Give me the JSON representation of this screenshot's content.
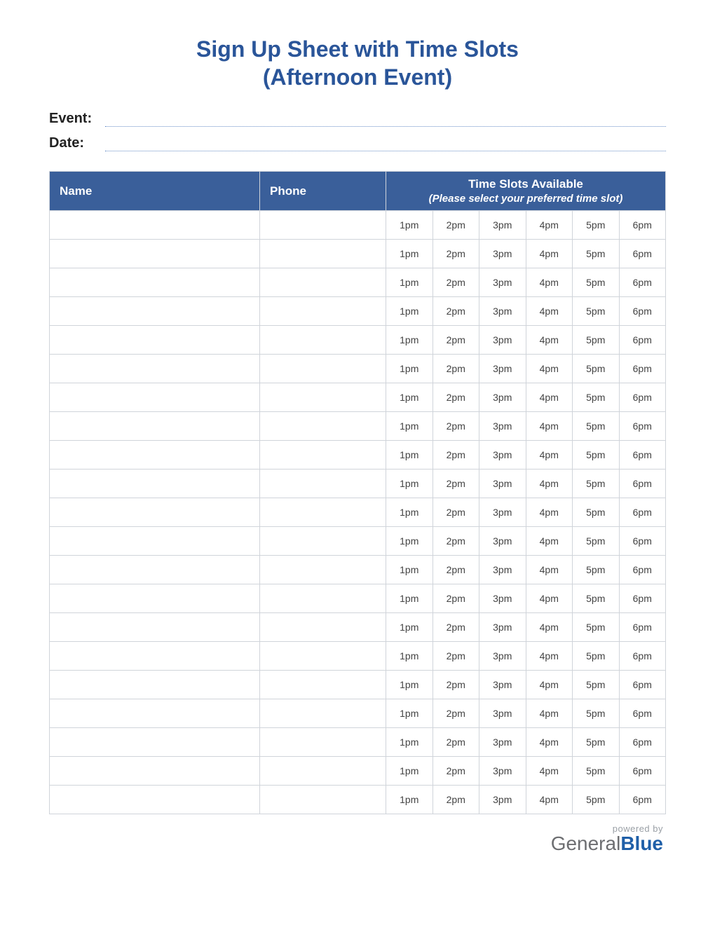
{
  "title_line1": "Sign Up Sheet with Time Slots",
  "title_line2": "(Afternoon Event)",
  "meta": {
    "event_label": "Event:",
    "event_value": "",
    "date_label": "Date:",
    "date_value": ""
  },
  "table": {
    "name_header": "Name",
    "phone_header": "Phone",
    "timeslots_header": "Time Slots Available",
    "timeslots_sub": "(Please select your preferred time slot)",
    "slots": [
      "1pm",
      "2pm",
      "3pm",
      "4pm",
      "5pm",
      "6pm"
    ],
    "row_count": 21
  },
  "footer": {
    "powered_by": "powered by",
    "brand_part1": "General",
    "brand_part2": "Blue"
  }
}
